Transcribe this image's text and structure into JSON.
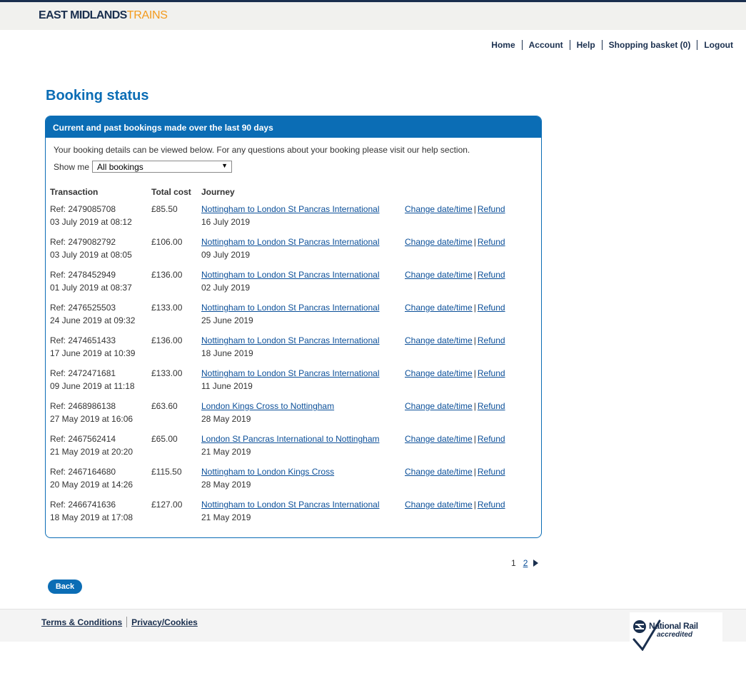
{
  "brand": {
    "logo_part1": "EAST MIDLANDS",
    "logo_part2": "TRAINS",
    "color_navy": "#1a2f4e",
    "color_orange": "#f39a1d",
    "color_blue": "#0b6db5"
  },
  "nav": {
    "home": "Home",
    "account": "Account",
    "help": "Help",
    "basket": "Shopping basket (0)",
    "logout": "Logout"
  },
  "page": {
    "title": "Booking status"
  },
  "panel": {
    "header": "Current and past bookings made over the last 90 days",
    "intro": "Your booking details can be viewed below. For any questions about your booking please visit our help section.",
    "filter_label": "Show me",
    "filter_value": "All bookings"
  },
  "table": {
    "headers": {
      "transaction": "Transaction",
      "total_cost": "Total cost",
      "journey": "Journey"
    },
    "action_change": "Change date/time",
    "action_refund": "Refund",
    "rows": [
      {
        "ref": "Ref: 2479085708",
        "booked": "03 July 2019 at 08:12",
        "cost": "£85.50",
        "journey": "Nottingham to London St Pancras International",
        "date": "16 July 2019"
      },
      {
        "ref": "Ref: 2479082792",
        "booked": "03 July 2019 at 08:05",
        "cost": "£106.00",
        "journey": "Nottingham to London St Pancras International",
        "date": "09 July 2019"
      },
      {
        "ref": "Ref: 2478452949",
        "booked": "01 July 2019 at 08:37",
        "cost": "£136.00",
        "journey": "Nottingham to London St Pancras International",
        "date": "02 July 2019"
      },
      {
        "ref": "Ref: 2476525503",
        "booked": "24 June 2019 at 09:32",
        "cost": "£133.00",
        "journey": "Nottingham to London St Pancras International",
        "date": "25 June 2019"
      },
      {
        "ref": "Ref: 2474651433",
        "booked": "17 June 2019 at 10:39",
        "cost": "£136.00",
        "journey": "Nottingham to London St Pancras International",
        "date": "18 June 2019"
      },
      {
        "ref": "Ref: 2472471681",
        "booked": "09 June 2019 at 11:18",
        "cost": "£133.00",
        "journey": "Nottingham to London St Pancras International",
        "date": "11 June 2019"
      },
      {
        "ref": "Ref: 2468986138",
        "booked": "27 May 2019 at 16:06",
        "cost": "£63.60",
        "journey": "London Kings Cross to Nottingham",
        "date": "28 May 2019"
      },
      {
        "ref": "Ref: 2467562414",
        "booked": "21 May 2019 at 20:20",
        "cost": "£65.00",
        "journey": "London St Pancras International to Nottingham",
        "date": "21 May 2019"
      },
      {
        "ref": "Ref: 2467164680",
        "booked": "20 May 2019 at 14:26",
        "cost": "£115.50",
        "journey": "Nottingham to London Kings Cross",
        "date": "28 May 2019"
      },
      {
        "ref": "Ref: 2466741636",
        "booked": "18 May 2019 at 17:08",
        "cost": "£127.00",
        "journey": "Nottingham to London St Pancras International",
        "date": "21 May 2019"
      }
    ]
  },
  "pagination": {
    "current": "1",
    "next_page": "2"
  },
  "back_label": "Back",
  "footer": {
    "terms": "Terms & Conditions",
    "privacy": "Privacy/Cookies",
    "badge_title": "National Rail",
    "badge_sub": "accredited"
  }
}
